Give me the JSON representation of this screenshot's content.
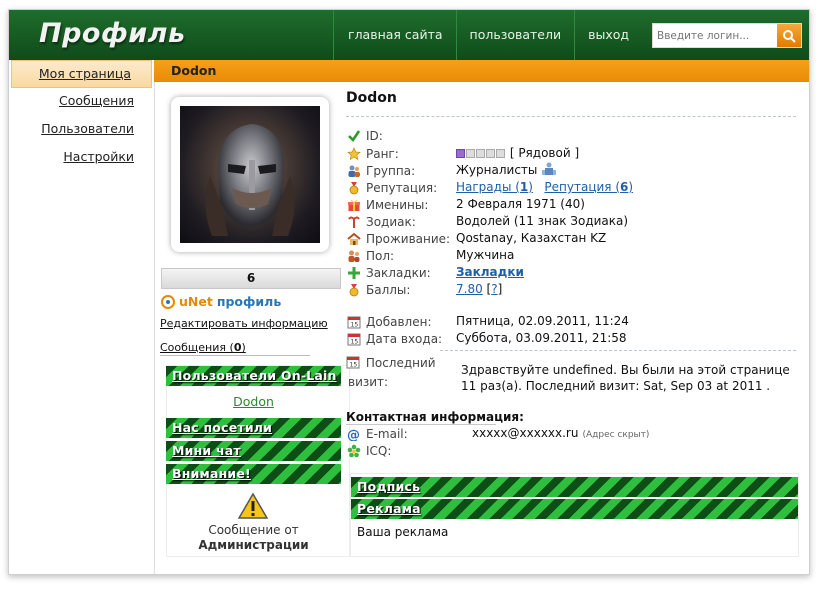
{
  "header": {
    "logo": "Профиль",
    "nav": [
      "главная сайта",
      "пользователи",
      "выход"
    ],
    "login_placeholder": "Введите логин..."
  },
  "sidebar": {
    "items": [
      {
        "label": "Моя страница",
        "active": true
      },
      {
        "label": "Сообщения"
      },
      {
        "label": "Пользователи"
      },
      {
        "label": "Настройки"
      }
    ]
  },
  "profile": {
    "title_bar": "Dodon",
    "name": "Dodon",
    "stat": "6",
    "unet_brand": "uNet",
    "unet_profile": "профиль",
    "edit_link": "Редактировать информацию",
    "messages_label": "Сообщения (",
    "messages_count": "0",
    "messages_close": ")"
  },
  "blocks": {
    "online": "Пользователи On-Lain",
    "online_user": "Dodon",
    "visited": "Нас посетили",
    "minichat": "Мини чат",
    "attention": "Внимание!",
    "admin_msg_1": "Сообщение от",
    "admin_msg_2": "Администрации",
    "signature": "Подпись",
    "ads": "Реклама",
    "ads_text": "Ваша реклама"
  },
  "info": {
    "id_label": "ID:",
    "rank_label": "Ранг:",
    "rank_value": "[ Рядовой ]",
    "rank_level": 1,
    "rank_max": 5,
    "group_label": "Группа:",
    "group_value": "Журналисты",
    "rep_label": "Репутация:",
    "awards_text": "Награды (",
    "awards_count": "1",
    "awards_close": ")",
    "rep_text": "Репутация (",
    "rep_count": "6",
    "rep_close": ")",
    "birthday_label": "Именины:",
    "birthday_value": "2 Февраля 1971 (40)",
    "zodiac_label": "Зодиак:",
    "zodiac_value": "Водолей (11 знак Зодиака)",
    "residence_label": "Проживание:",
    "residence_value": "Qostanay, Казахстан KZ",
    "gender_label": "Пол:",
    "gender_value": "Мужчина",
    "bookmarks_label": "Закладки:",
    "bookmarks_value": "Закладки",
    "points_label": "Баллы:",
    "points_value": "7.80",
    "points_help": "?",
    "added_label": "Добавлен:",
    "added_value": "Пятница, 02.09.2011, 11:24",
    "login_label": "Дата входа:",
    "login_value": "Суббота, 03.09.2011, 21:58",
    "last_visit_label_1": "Последний",
    "last_visit_label_2": "визит:",
    "greeting": "Здравствуйте undefined. Вы были на этой странице 11 раз(а). Последний визит: Sat, Sep 03 at 2011 .",
    "contact_heading": "Контактная информация:",
    "email_label": "E-mail:",
    "email_value": "xxxxx@xxxxxx.ru",
    "email_note": "(Адрес скрыт)",
    "icq_label": "ICQ:"
  },
  "colors": {
    "header_green": "#1f6d2c",
    "accent_orange": "#f6a01c",
    "stripe_dark": "#0d4e17",
    "stripe_light": "#2fbf3e",
    "link_blue": "#1f5fa8"
  }
}
